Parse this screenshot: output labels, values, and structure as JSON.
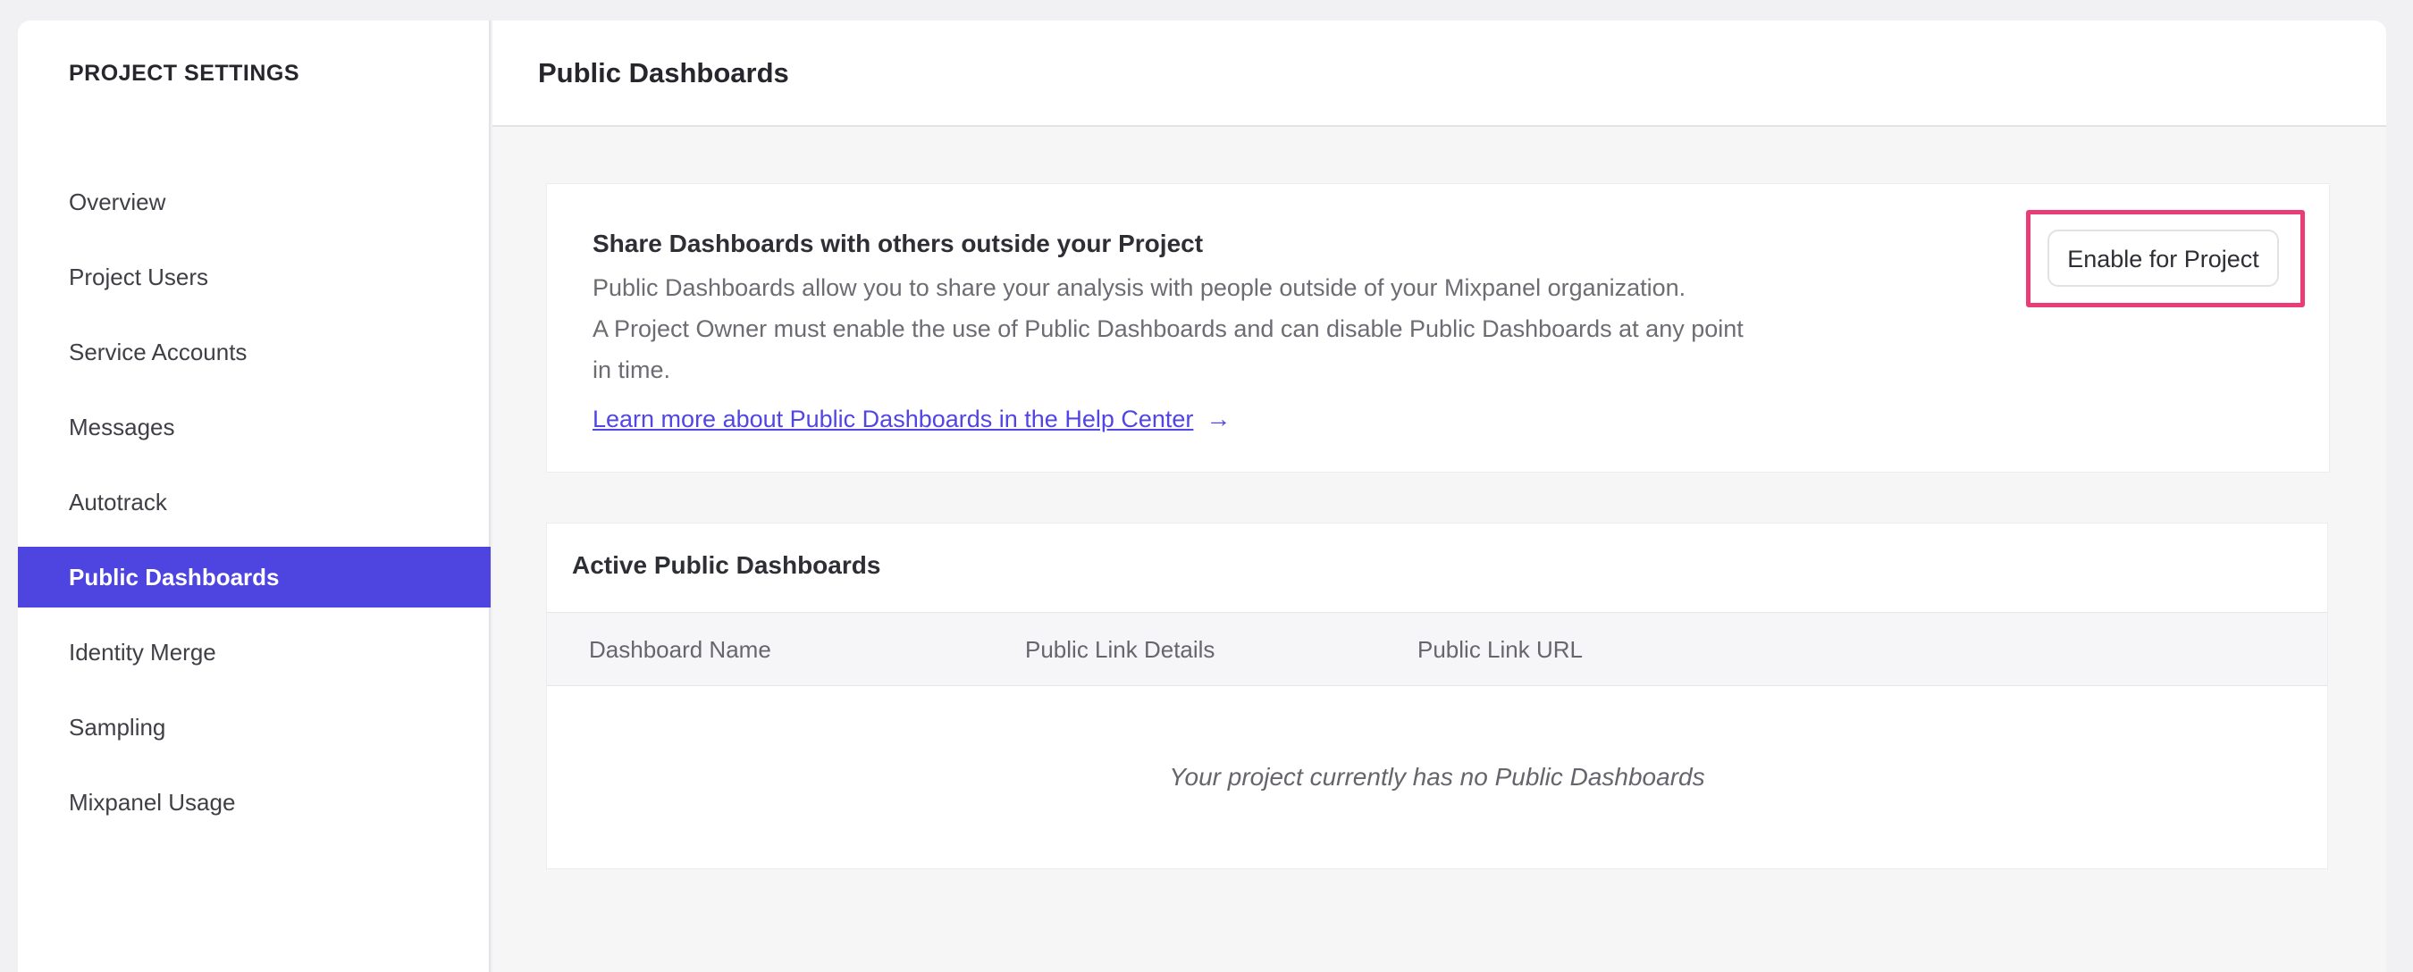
{
  "sidebar": {
    "title": "PROJECT SETTINGS",
    "items": [
      {
        "label": "Overview",
        "selected": false
      },
      {
        "label": "Project Users",
        "selected": false
      },
      {
        "label": "Service Accounts",
        "selected": false
      },
      {
        "label": "Messages",
        "selected": false
      },
      {
        "label": "Autotrack",
        "selected": false
      },
      {
        "label": "Public Dashboards",
        "selected": true
      },
      {
        "label": "Identity Merge",
        "selected": false
      },
      {
        "label": "Sampling",
        "selected": false
      },
      {
        "label": "Mixpanel Usage",
        "selected": false
      }
    ]
  },
  "header": {
    "title": "Public Dashboards"
  },
  "share_card": {
    "title": "Share Dashboards with others outside your Project",
    "description_line1": "Public Dashboards allow you to share your analysis with people outside of your Mixpanel organization.",
    "description_line2": "A Project Owner must enable the use of Public Dashboards and can disable Public Dashboards at any point in time.",
    "link_label": "Learn more about Public Dashboards in the Help Center",
    "arrow_icon": "→",
    "button_label": "Enable for Project"
  },
  "active_dashboards": {
    "title": "Active Public Dashboards",
    "columns": [
      "Dashboard Name",
      "Public Link Details",
      "Public Link URL"
    ],
    "rows": [],
    "empty_message": "Your project currently has no Public Dashboards"
  },
  "colors": {
    "accent_purple": "#4e44e0",
    "link_purple": "#5246e3",
    "annotation_pink": "#ea3d78"
  }
}
